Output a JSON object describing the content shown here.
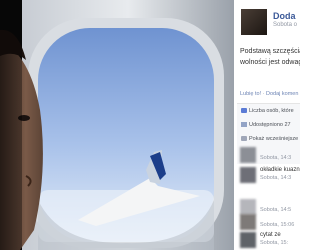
{
  "post": {
    "author": "Doda",
    "date": "Sobota o",
    "caption_line1": "Podstawą szczęścia",
    "caption_line2": "wolności jest odwag",
    "actions": {
      "like": "Lubię to!",
      "separator": " · ",
      "comment": "Dodaj komen"
    }
  },
  "meta": {
    "likes": "Liczba osób, które",
    "shares": "Udostępniono 27",
    "show_more": "Pokaż wcześniejsze"
  },
  "comments": [
    {
      "text": "",
      "time": "Sobota, 14:3"
    },
    {
      "text": "okładkie kuazn",
      "time": "Sobota, 14:3"
    },
    {
      "text": "",
      "time": "Sobota, 14:5"
    },
    {
      "text": "",
      "time": "Sobota, 15:06"
    },
    {
      "text": "cytat ze",
      "time": "Sobota, 15:"
    }
  ],
  "colors": {
    "link": "#3b5998",
    "sky": "#7fa0d8",
    "muted": "#9197a3"
  }
}
